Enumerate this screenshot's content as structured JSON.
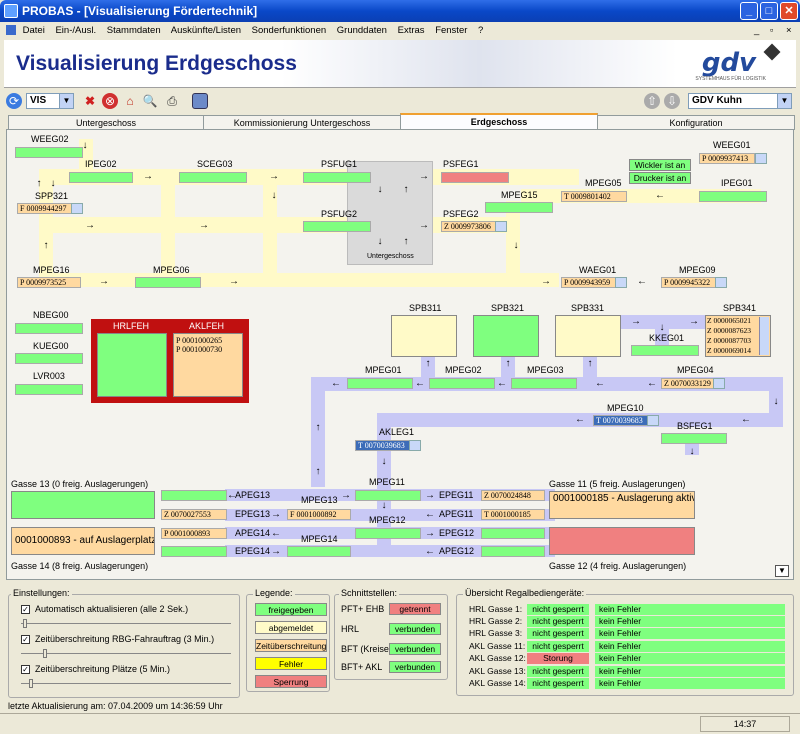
{
  "window": {
    "title": "PROBAS - [Visualisierung Fördertechnik]",
    "min": "_",
    "max": "□",
    "close": "✕",
    "inner_min": "_",
    "inner_max": "▫",
    "inner_close": "×"
  },
  "menu": [
    "Datei",
    "Ein-/Ausl.",
    "Stammdaten",
    "Auskünfte/Listen",
    "Sonderfunktionen",
    "Grunddaten",
    "Extras",
    "Fenster",
    "?"
  ],
  "banner": {
    "title": "Visualisierung Erdgeschoss",
    "logo": "gdv",
    "logo_sub": "SYSTEMHAUS FÜR LOGISTIK"
  },
  "toolbar": {
    "combo": "VIS",
    "user": "GDV Kuhn"
  },
  "tabs": [
    "Untergeschoss",
    "Kommissionierung Untergeschoss",
    "Erdgeschoss",
    "Konfiguration"
  ],
  "stations": {
    "weeg02": "WEEG02",
    "ipeg02": "IPEG02",
    "sceg03": "SCEG03",
    "psfug1": "PSFUG1",
    "psfeg1": "PSFEG1",
    "weeg01": "WEEG01",
    "spp321": "SPP321",
    "mpeg05": "MPEG05",
    "mpeg15": "MPEG15",
    "ipeg01": "IPEG01",
    "psfug2": "PSFUG2",
    "psfeg2": "PSFEG2",
    "untergeschoss": "Untergeschoss",
    "mpeg16": "MPEG16",
    "mpeg06": "MPEG06",
    "waeg01": "WAEG01",
    "mpeg09": "MPEG09",
    "nbeg00": "NBEG00",
    "kueg00": "KUEG00",
    "lvr003": "LVR003",
    "hrlfeh": "HRLFEH",
    "aklfeh": "AKLFEH",
    "spb311": "SPB311",
    "spb321": "SPB321",
    "spb331": "SPB331",
    "spb341": "SPB341",
    "kkeg01": "KKEG01",
    "mpeg01": "MPEG01",
    "mpeg02": "MPEG02",
    "mpeg03": "MPEG03",
    "mpeg04": "MPEG04",
    "mpeg10": "MPEG10",
    "bsfeg1": "BSFEG1",
    "akleg1": "AKLEG1",
    "mpeg11": "MPEG11",
    "apeg13": "APEG13",
    "mpeg13": "MPEG13",
    "epeg11": "EPEG11",
    "epeg13": "EPEG13",
    "apeg11": "APEG11",
    "apeg14": "APEG14",
    "mpeg12": "MPEG12",
    "epeg12": "EPEG12",
    "epeg14": "EPEG14",
    "mpeg14": "MPEG14",
    "apeg12": "APEG12"
  },
  "orders": {
    "weeg01": "P 0009937413",
    "spp321": "F 0009944297",
    "mpeg05": "T 0009801402",
    "psfeg2": "Z 0009973806",
    "mpeg16": "P 0009973525",
    "waeg01": "P 0009943959",
    "mpeg09": "P 0009945322",
    "aklfeh": [
      "P 0001000265",
      "P 0001000730"
    ],
    "spb341": [
      "Z 0000065021",
      "Z 0000087623",
      "Z 0000087703",
      "Z 0000069014"
    ],
    "mpeg04": "Z 0070033129",
    "mpeg10": "T 0070039683",
    "akleg1": "T 0070039683",
    "apeg13": "Z 0070027553",
    "mpeg13": "F 0001000892",
    "epeg11": "Z 0070024848",
    "apeg11": "T 0001000185",
    "apeg14": "P 0001000893"
  },
  "info": {
    "wickler": "Wickler ist an",
    "drucker": "Drucker ist an"
  },
  "gassen": {
    "g13": "Gasse 13 (0 freig. Auslagerungen)",
    "g11": "Gasse 11 (5 freig. Auslagerungen)",
    "g14": "Gasse 14 (8 freig. Auslagerungen)",
    "g12": "Gasse 12 (4 freig. Auslagerungen)",
    "g11_text": "0001000185 - Auslagerung aktiv",
    "g14_text": "0001000893 - auf Auslagerplatz"
  },
  "settings": {
    "title": "Einstellungen:",
    "auto": "Automatisch aktualisieren (alle 2 Sek.)",
    "rbg": "Zeitüberschreitung RBG-Fahrauftrag (3 Min.)",
    "plaetze": "Zeitüberschreitung Plätze (5 Min.)"
  },
  "legend": {
    "title": "Legende:",
    "items": [
      "freigegeben",
      "abgemeldet",
      "Zeitüberschreitung",
      "Fehler",
      "Sperrung"
    ],
    "colors": {
      "freigegeben": "#7fff7f",
      "abgemeldet": "#fffac8",
      "zeit": "#ffd9a0",
      "fehler": "#ffff00",
      "sperrung": "#f08080"
    }
  },
  "interfaces": {
    "title": "Schnittstellen:",
    "rows": [
      {
        "name": "PFT+ EHB",
        "status": "getrennt"
      },
      {
        "name": "HRL",
        "status": "verbunden"
      },
      {
        "name": "BFT (Kreisel)",
        "status": "verbunden"
      },
      {
        "name": "BFT+ AKL",
        "status": "verbunden"
      }
    ]
  },
  "overview": {
    "title": "Übersicht Regalbediengeräte:",
    "rows": [
      {
        "name": "HRL Gasse 1:",
        "state": "nicht gesperrt",
        "err": "kein Fehler"
      },
      {
        "name": "HRL Gasse 2:",
        "state": "nicht gesperrt",
        "err": "kein Fehler"
      },
      {
        "name": "HRL Gasse 3:",
        "state": "nicht gesperrt",
        "err": "kein Fehler"
      },
      {
        "name": "AKL Gasse 11:",
        "state": "nicht gesperrt",
        "err": "kein Fehler"
      },
      {
        "name": "AKL Gasse 12:",
        "state": "Storung",
        "err": "kein Fehler"
      },
      {
        "name": "AKL Gasse 13:",
        "state": "nicht gesperrt",
        "err": "kein Fehler"
      },
      {
        "name": "AKL Gasse 14:",
        "state": "nicht gesperrt",
        "err": "kein Fehler"
      }
    ]
  },
  "status": {
    "last_update": "letzte Aktualisierung am: 07.04.2009 um 14:36:59 Uhr",
    "clock": "14:37"
  }
}
